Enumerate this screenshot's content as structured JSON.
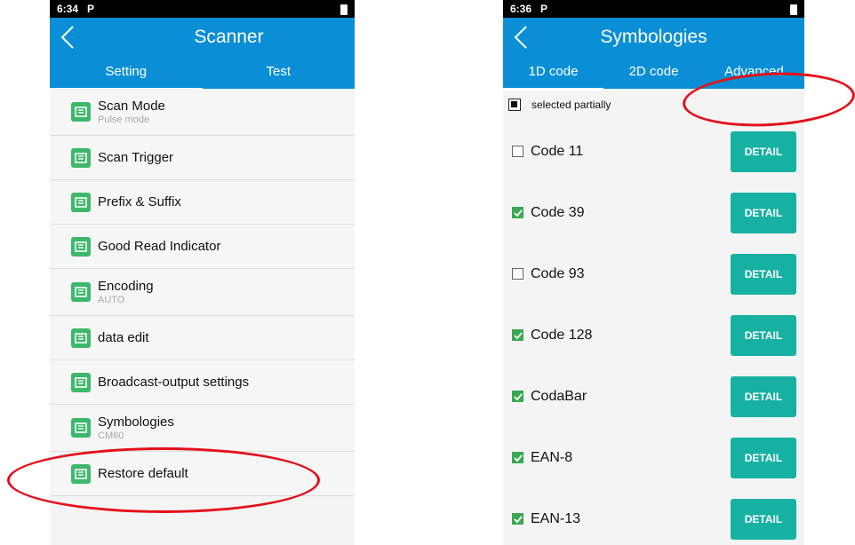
{
  "left": {
    "status_time": "6:34",
    "status_p": "P",
    "title": "Scanner",
    "tabs": [
      {
        "label": "Setting",
        "active": true
      },
      {
        "label": "Test",
        "active": false
      }
    ],
    "items": [
      {
        "label": "Scan Mode",
        "sub": "Pulse mode",
        "icon": "scan-mode-icon"
      },
      {
        "label": "Scan Trigger",
        "sub": "",
        "icon": "scan-trigger-icon"
      },
      {
        "label": "Prefix & Suffix",
        "sub": "",
        "icon": "prefix-suffix-icon"
      },
      {
        "label": "Good Read Indicator",
        "sub": "",
        "icon": "good-read-indicator-icon"
      },
      {
        "label": "Encoding",
        "sub": "AUTO",
        "icon": "barcode-icon"
      },
      {
        "label": "data edit",
        "sub": "",
        "icon": "data-edit-icon"
      },
      {
        "label": "Broadcast-output settings",
        "sub": "",
        "icon": "broadcast-output-icon"
      },
      {
        "label": "Symbologies",
        "sub": "CM60",
        "icon": "symbologies-icon"
      },
      {
        "label": "Restore default",
        "sub": "",
        "icon": "restore-clock-icon"
      }
    ]
  },
  "right": {
    "status_time": "6:36",
    "status_p": "P",
    "title": "Symbologies",
    "tabs": [
      {
        "label": "1D code",
        "active": true
      },
      {
        "label": "2D code",
        "active": false
      },
      {
        "label": "Advanced",
        "active": false
      }
    ],
    "selected_label": "selected partially",
    "detail_label": "DETAIL",
    "symbologies": [
      {
        "label": "Code 11",
        "checked": false
      },
      {
        "label": "Code 39",
        "checked": true
      },
      {
        "label": "Code 93",
        "checked": false
      },
      {
        "label": "Code 128",
        "checked": true
      },
      {
        "label": "CodaBar",
        "checked": true
      },
      {
        "label": "EAN-8",
        "checked": true
      },
      {
        "label": "EAN-13",
        "checked": true
      }
    ]
  },
  "colors": {
    "app_blue": "#0a8fd6",
    "icon_green": "#3db86b",
    "detail_teal": "#17b1a3",
    "check_green": "#3aa852",
    "annotation_red": "#e3101a"
  }
}
